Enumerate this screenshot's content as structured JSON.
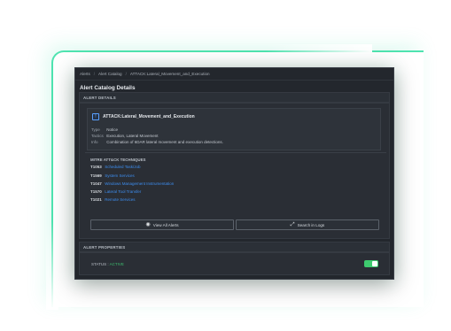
{
  "breadcrumb": {
    "items": [
      "Alerts",
      "Alert Catalog",
      "ATTACK:Lateral_Movement_and_Execution"
    ]
  },
  "page": {
    "title": "Alert Catalog Details"
  },
  "alert_details": {
    "header": "ALERT DETAILS",
    "name": "ATTACK:Lateral_Movement_and_Execution",
    "fields": [
      {
        "key": "Type",
        "value": "Notice"
      },
      {
        "key": "Tactics",
        "value": "Execution, Lateral Movement"
      },
      {
        "key": "Info",
        "value": "Combination of 6DAR lateral movement and execution detections."
      }
    ]
  },
  "mitre": {
    "title": "MITRE ATT&CK TECHNIQUES",
    "techniques": [
      {
        "id": "T1053",
        "name": "Scheduled Task/Job"
      },
      {
        "id": "T1569",
        "name": "System Services"
      },
      {
        "id": "T1047",
        "name": "Windows Management Instrumentation"
      },
      {
        "id": "T1570",
        "name": "Lateral Tool Transfer"
      },
      {
        "id": "T1021",
        "name": "Remote Services"
      }
    ]
  },
  "actions": {
    "view_alerts": "View All Alerts",
    "search_logs": "Search in Logs"
  },
  "properties": {
    "header": "ALERT PROPERTIES",
    "status_label": "STATUS :",
    "status_value": "ACTIVE",
    "toggle_on": true
  },
  "colors": {
    "accent_glow": "#4fe3b0",
    "link": "#3d8ef0",
    "active": "#3ecb6f"
  },
  "icons": {
    "alert": "alert-icon",
    "view": "eye-icon",
    "search": "expand-search-icon"
  }
}
